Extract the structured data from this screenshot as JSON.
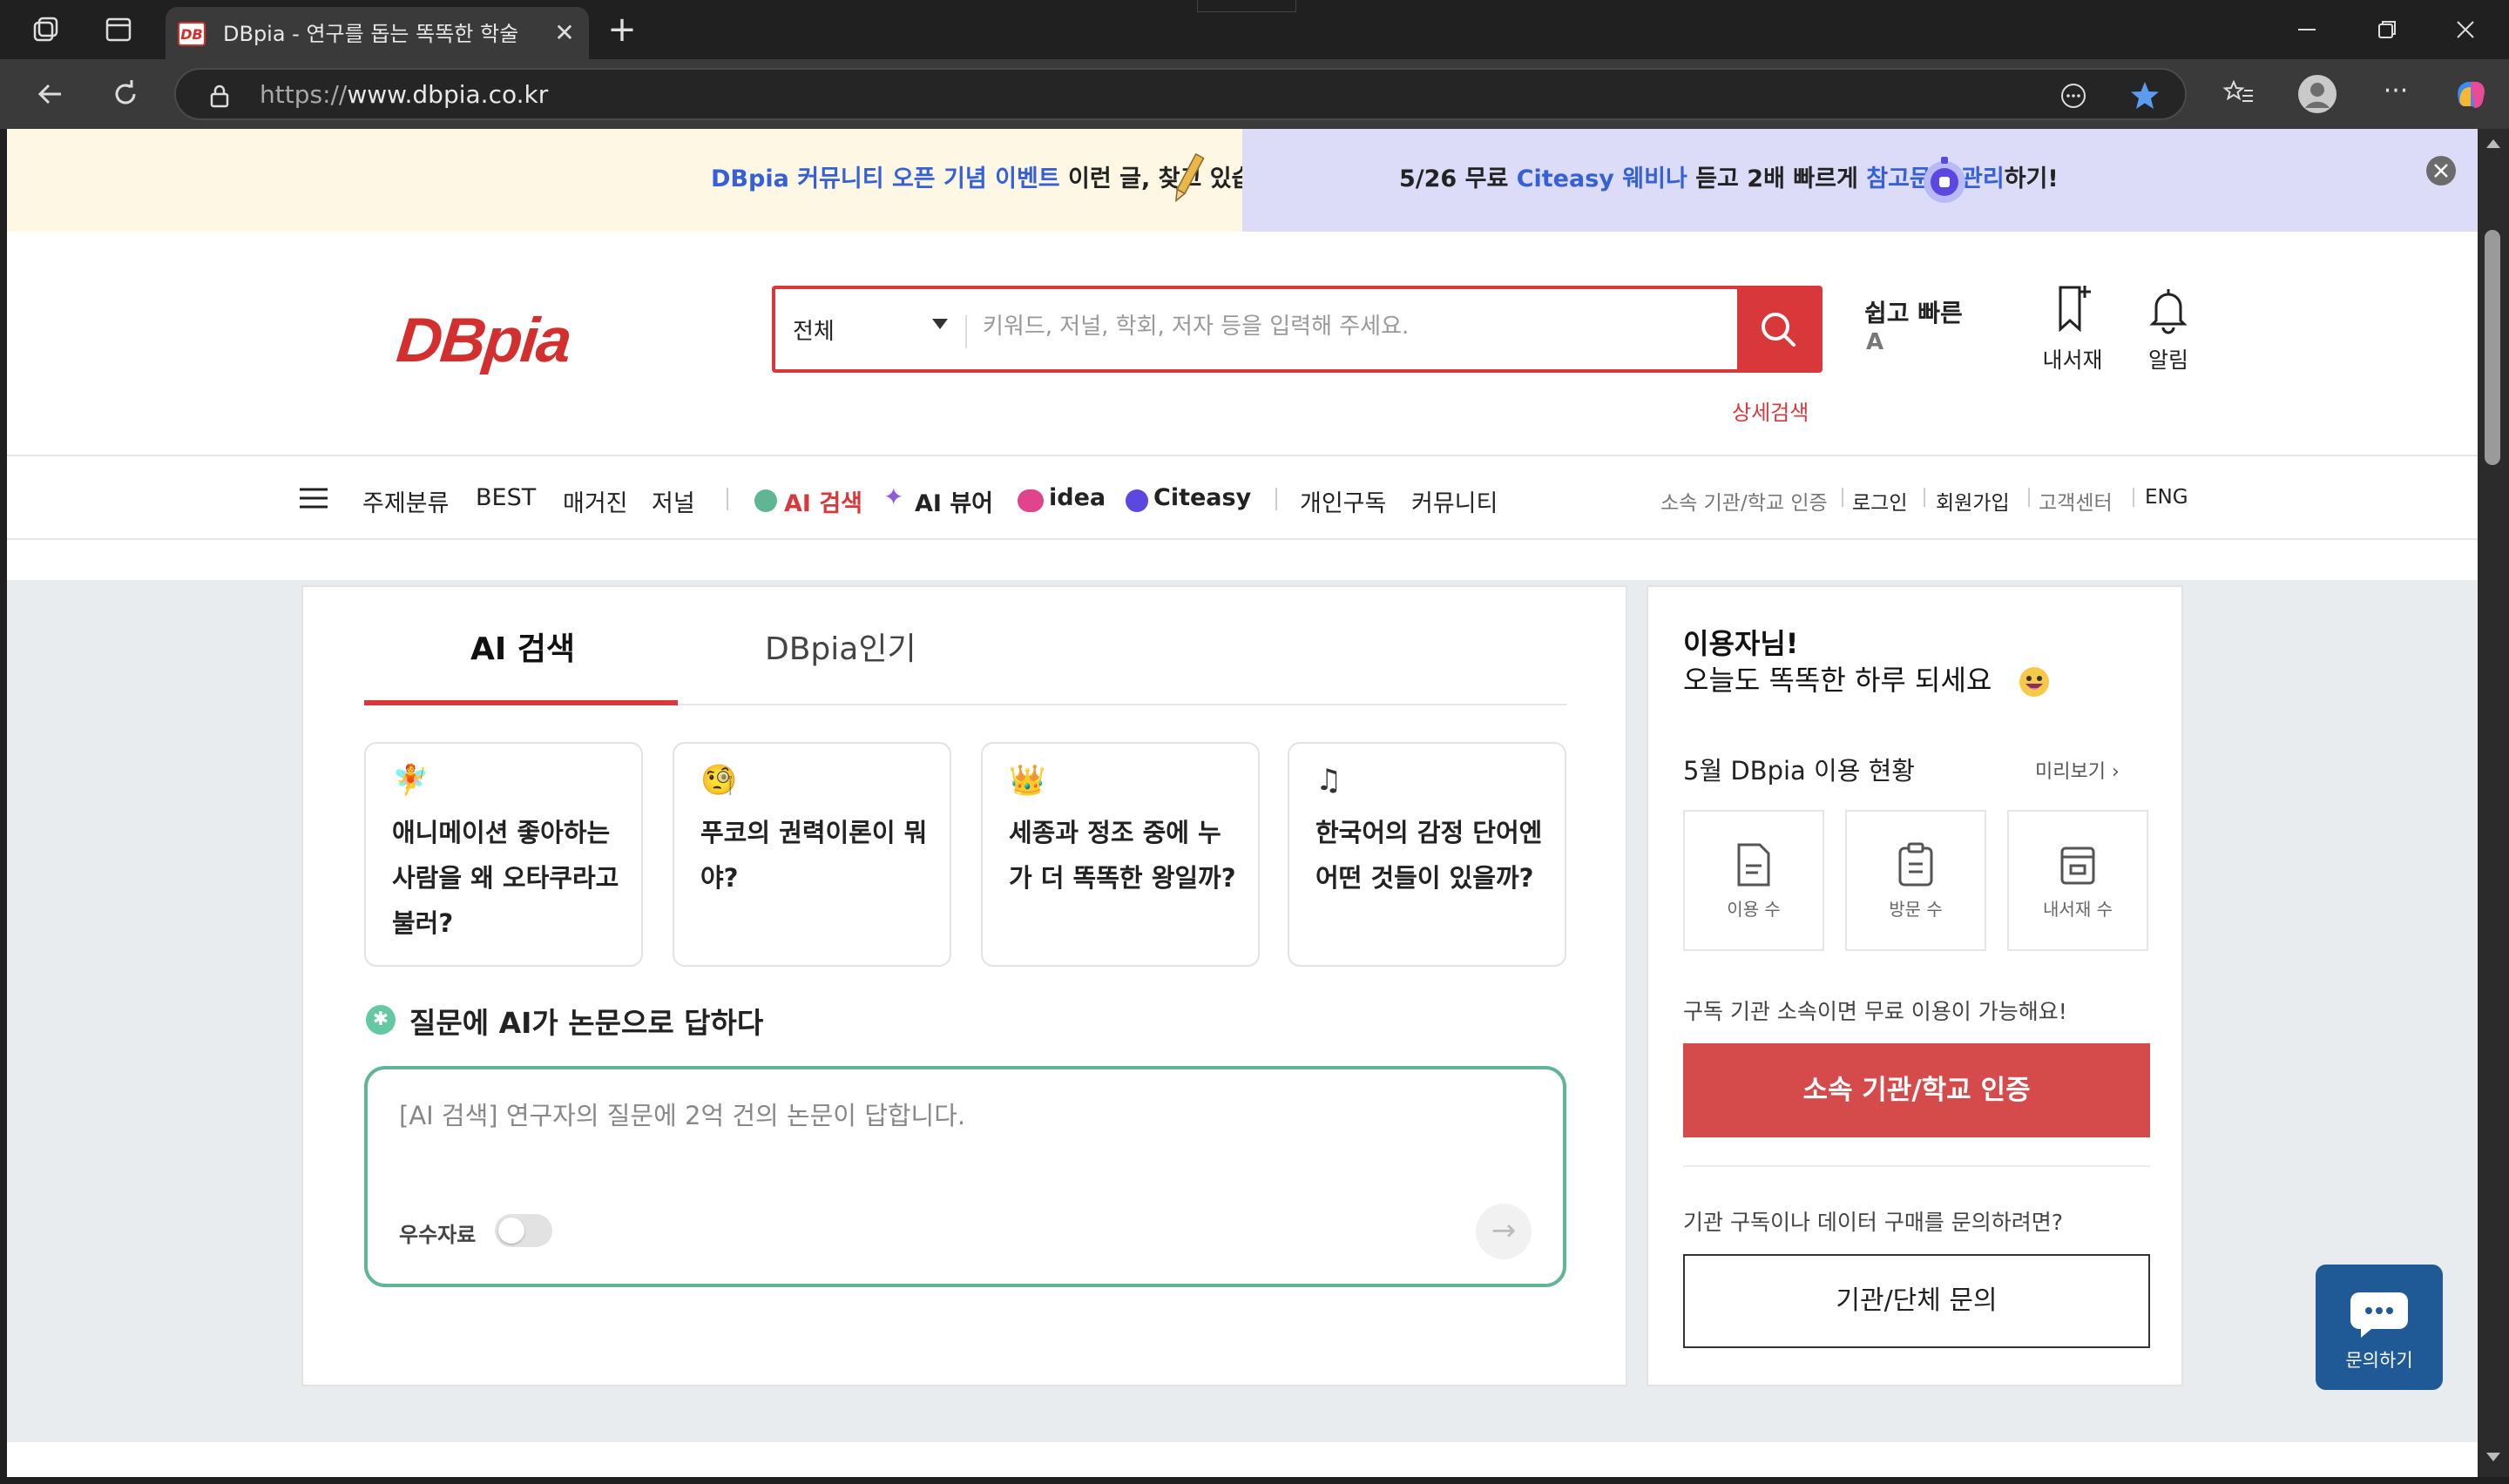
{
  "browser": {
    "tab_title": "DBpia - 연구를 돕는 똑똑한 학술",
    "tab_favicon": "DB",
    "url_scheme": "https://",
    "url_host": "www.dbpia.co.kr"
  },
  "banner": {
    "left_highlight": "DBpia 커뮤니티 오픈 기념 이벤트",
    "left_text": " 이런 글, 찾고 있습니다",
    "right_pre": "5/26 무료 ",
    "right_highlight1": "Citeasy 웨비나",
    "right_mid": " 듣고 2배 빠르게 ",
    "right_highlight2": "참고문헌 관리",
    "right_post": "하기!"
  },
  "header": {
    "logo": "DBpia",
    "search_category": "전체",
    "search_placeholder": "키워드, 저널, 학회, 저자 등을 입력해 주세요.",
    "advanced_search": "상세검색",
    "quick_label": "쉽고 빠른",
    "quick_letter": "A",
    "library_label": "내서재",
    "alarm_label": "알림"
  },
  "nav": {
    "subject": "주제분류",
    "best": "BEST",
    "magazine": "매거진",
    "journal": "저널",
    "ai_search": "AI 검색",
    "ai_viewer": "AI 뷰어",
    "idea": "idea",
    "citeasy": "Citeasy",
    "subscribe": "개인구독",
    "community": "커뮤니티",
    "inst_auth": "소속 기관/학교 인증",
    "login": "로그인",
    "signup": "회원가입",
    "support": "고객센터",
    "eng": "ENG"
  },
  "main": {
    "tab_ai": "AI 검색",
    "tab_popular": "DBpia인기",
    "questions": [
      {
        "icon": "fairy-icon",
        "glyph": "🧚",
        "text": "애니메이션 좋아하는 사람을 왜 오타쿠라고 불러?"
      },
      {
        "icon": "monocle-face-icon",
        "glyph": "🧐",
        "text": "푸코의 권력이론이 뭐야?"
      },
      {
        "icon": "crown-icon",
        "glyph": "👑",
        "text": "세종과 정조 중에 누가 더 똑똑한 왕일까?"
      },
      {
        "icon": "music-note-icon",
        "glyph": "♫",
        "text": "한국어의 감정 단어엔 어떤 것들이 있을까?"
      }
    ],
    "ai_heading": "질문에 AI가 논문으로 답하다",
    "ai_placeholder": "[AI 검색] 연구자의 질문에 2억 건의 논문이 답합니다.",
    "toggle_label": "우수자료"
  },
  "side": {
    "greet_name": "이용자님!",
    "greet_msg": "오늘도 똑똑한 하루 되세요",
    "usage_title": "5월 DBpia 이용 현황",
    "preview": "미리보기 ›",
    "stats": [
      {
        "label": "이용 수",
        "icon": "document-icon"
      },
      {
        "label": "방문 수",
        "icon": "clipboard-icon"
      },
      {
        "label": "내서재 수",
        "icon": "archive-icon"
      }
    ],
    "sub_note": "구독 기관 소속이면 무료 이용이 가능해요!",
    "auth_button": "소속 기관/학교 인증",
    "inquiry_note": "기관 구독이나 데이터 구매를 문의하려면?",
    "inquiry_button": "기관/단체 문의"
  },
  "chat": {
    "label": "문의하기"
  },
  "colors": {
    "brand_red": "#d9383a",
    "ai_green": "#5fb594",
    "link_blue": "#3560d8",
    "chat_blue": "#1f5a96"
  }
}
